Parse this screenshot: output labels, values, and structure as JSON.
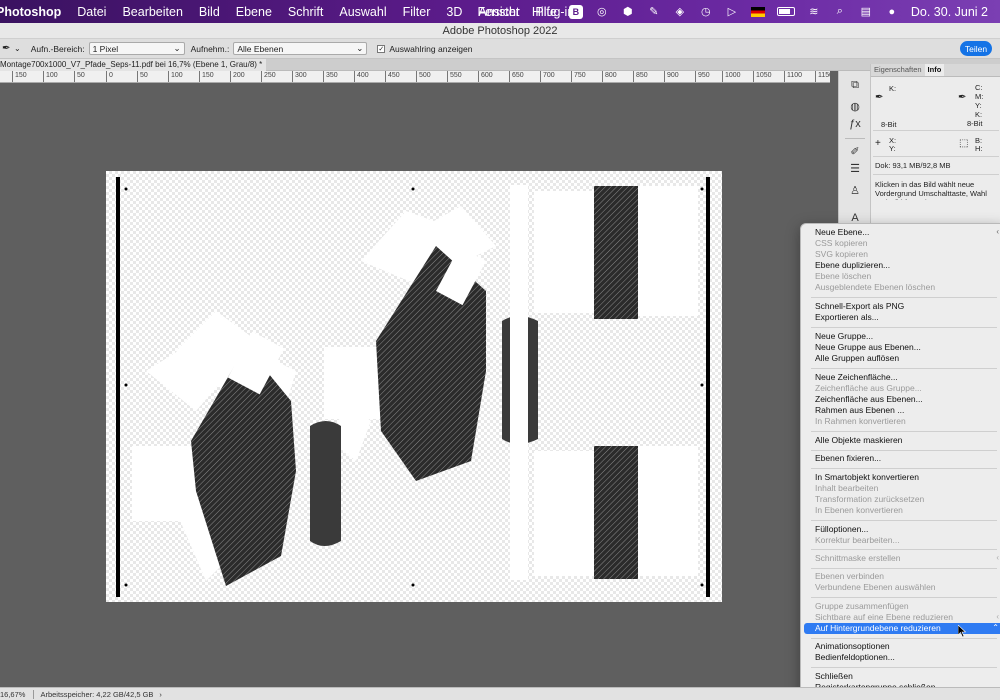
{
  "menubar": {
    "app_name": "Photoshop",
    "items": [
      "Datei",
      "Bearbeiten",
      "Bild",
      "Ebene",
      "Schrift",
      "Auswahl",
      "Filter",
      "3D",
      "Ansicht",
      "Plug-ins"
    ],
    "right_items": [
      "Fenster",
      "Hilfe"
    ],
    "clock": "Do. 30. Juni  2"
  },
  "window": {
    "title": "Adobe Photoshop 2022"
  },
  "options_bar": {
    "sample_label": "Aufn.-Bereich:",
    "sample_value": "1 Pixel",
    "layers_label": "Aufnehm.:",
    "layers_value": "Alle Ebenen",
    "ring_label": "Auswahlring anzeigen",
    "share_label": "Teilen"
  },
  "document_tab": {
    "label": "Montage700x1000_V7_Pfade_Seps-11.pdf bei 16,7% (Ebene 1, Grau/8) *"
  },
  "ruler": {
    "ticks": [
      "150",
      "100",
      "50",
      "0",
      "50",
      "100",
      "150",
      "200",
      "250",
      "300",
      "350",
      "400",
      "450",
      "500",
      "550",
      "600",
      "650",
      "700",
      "750",
      "800",
      "850",
      "900",
      "950",
      "1000",
      "1050",
      "1100",
      "1150"
    ]
  },
  "info_panel": {
    "tabs": [
      "Eigenschaften",
      "Info"
    ],
    "active_tab": "Info",
    "k_label": "K:",
    "bit_left": "8-Bit",
    "c_label": "C:",
    "m_label": "M:",
    "y_label": "Y:",
    "k2_label": "K:",
    "bit_right": "8-Bit",
    "x_label": "X:",
    "y2_label": "Y:",
    "b_label": "B:",
    "h_label": "H:",
    "doc_size": "Dok: 93,1 MB/92,8 MB",
    "hint": "Klicken in das Bild wählt neue Vordergrund Umschalttaste, Wahl und Bfhl für weitere"
  },
  "context_menu": {
    "items": [
      {
        "label": "Neue Ebene...",
        "enabled": true
      },
      {
        "label": "CSS kopieren",
        "enabled": false
      },
      {
        "label": "SVG kopieren",
        "enabled": false
      },
      {
        "label": "Ebene duplizieren...",
        "enabled": true
      },
      {
        "label": "Ebene löschen",
        "enabled": false
      },
      {
        "label": "Ausgeblendete Ebenen löschen",
        "enabled": false
      },
      {
        "label": "Schnell-Export als PNG",
        "enabled": true
      },
      {
        "label": "Exportieren als...",
        "enabled": true
      },
      {
        "label": "Neue Gruppe...",
        "enabled": true
      },
      {
        "label": "Neue Gruppe aus Ebenen...",
        "enabled": true
      },
      {
        "label": "Alle Gruppen auflösen",
        "enabled": true
      },
      {
        "label": "Neue Zeichenfläche...",
        "enabled": true
      },
      {
        "label": "Zeichenfläche aus Gruppe...",
        "enabled": false
      },
      {
        "label": "Zeichenfläche aus Ebenen...",
        "enabled": true
      },
      {
        "label": "Rahmen aus Ebenen ...",
        "enabled": true
      },
      {
        "label": "In Rahmen konvertieren",
        "enabled": false
      },
      {
        "label": "Alle Objekte maskieren",
        "enabled": true
      },
      {
        "label": "Ebenen fixieren...",
        "enabled": true
      },
      {
        "label": "In Smartobjekt konvertieren",
        "enabled": true
      },
      {
        "label": "Inhalt bearbeiten",
        "enabled": false
      },
      {
        "label": "Transformation zurücksetzen",
        "enabled": false
      },
      {
        "label": "In Ebenen konvertieren",
        "enabled": false
      },
      {
        "label": "Fülloptionen...",
        "enabled": true
      },
      {
        "label": "Korrektur bearbeiten...",
        "enabled": false
      },
      {
        "label": "Schnittmaske erstellen",
        "enabled": false
      },
      {
        "label": "Ebenen verbinden",
        "enabled": false
      },
      {
        "label": "Verbundene Ebenen auswählen",
        "enabled": false
      },
      {
        "label": "Gruppe zusammenfügen",
        "enabled": false
      },
      {
        "label": "Sichtbare auf eine Ebene reduzieren",
        "enabled": false
      },
      {
        "label": "Auf Hintergrundebene reduzieren",
        "enabled": true,
        "highlighted": true
      },
      {
        "label": "Animationsoptionen",
        "enabled": true
      },
      {
        "label": "Bedienfeldoptionen...",
        "enabled": true
      },
      {
        "label": "Schließen",
        "enabled": true
      },
      {
        "label": "Registerkartengruppe schließen",
        "enabled": true
      }
    ]
  },
  "status_bar": {
    "zoom": "16,67%",
    "scratch": "Arbeitsspeicher: 4,22 GB/42,5 GB"
  },
  "colors": {
    "accent": "#2f7bf2",
    "share": "#1473e6",
    "menubar": "#5b1b8a"
  }
}
